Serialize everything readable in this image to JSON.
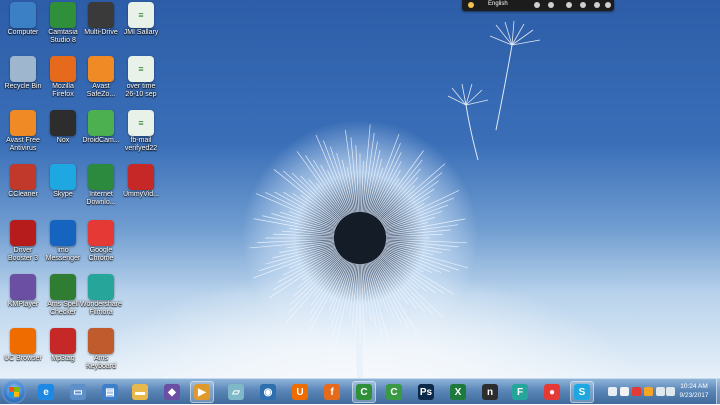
{
  "desktop": {
    "icons": [
      {
        "label": "Computer",
        "icon": "computer-icon",
        "color": "#3b7fc4"
      },
      {
        "label": "Camtasia\nStudio 8",
        "icon": "camtasia-icon",
        "color": "#2f8f3a"
      },
      {
        "label": "Multi-Drive",
        "icon": "nox-icon",
        "color": "#3a3a3a"
      },
      {
        "label": "JMI Sallary",
        "icon": "document-icon",
        "color": "#e8f2e8"
      },
      {
        "label": "Recycle Bin",
        "icon": "recycle-bin-icon",
        "color": "#9fb6cf"
      },
      {
        "label": "Mozilla\nFirefox",
        "icon": "firefox-icon",
        "color": "#e56a1c"
      },
      {
        "label": "Avast\nSafeZo...",
        "icon": "avast-icon",
        "color": "#f08a24"
      },
      {
        "label": "over time\n26-10 sep",
        "icon": "document-icon",
        "color": "#e8f2e8"
      },
      {
        "label": "Avast Free\nAntivirus",
        "icon": "avast-icon",
        "color": "#f08a24"
      },
      {
        "label": "Nox",
        "icon": "nox-icon",
        "color": "#2d2d2d"
      },
      {
        "label": "DroidCam...",
        "icon": "droidcam-icon",
        "color": "#4caf50"
      },
      {
        "label": "fb-mail\nverifyed22",
        "icon": "document-icon",
        "color": "#e8f2e8"
      },
      {
        "label": "CCleaner",
        "icon": "ccleaner-icon",
        "color": "#c0392b"
      },
      {
        "label": "Skype",
        "icon": "skype-icon",
        "color": "#1ea7e1"
      },
      {
        "label": "Internet\nDownlo...",
        "icon": "internet-download-icon",
        "color": "#2b8a3e"
      },
      {
        "label": "UmmyVid...",
        "icon": "download-icon",
        "color": "#c62828"
      },
      {
        "label": "Driver\nBooster 3",
        "icon": "driver-booster-icon",
        "color": "#b71c1c"
      },
      {
        "label": "imo\nMessenger",
        "icon": "imo-icon",
        "color": "#1565c0"
      },
      {
        "label": "Google\nChrome",
        "icon": "chrome-icon",
        "color": "#e53935"
      },
      {
        "label": "KMPlayer",
        "icon": "kmplayer-icon",
        "color": "#6a4fa3"
      },
      {
        "label": "Ams Spell\nChecker",
        "icon": "spell-checker-icon",
        "color": "#2e7d32"
      },
      {
        "label": "Wondershare\nFilmora",
        "icon": "filmora-icon",
        "color": "#26a69a"
      },
      {
        "label": "UC Browser",
        "icon": "uc-browser-icon",
        "color": "#ef6c00"
      },
      {
        "label": "Mp3tag",
        "icon": "mp3tag-icon",
        "color": "#c62828"
      },
      {
        "label": "Ams\nKeyboard",
        "icon": "keyboard-icon",
        "color": "#bf5b2c"
      }
    ]
  },
  "toolbar_widget": {
    "language": "English"
  },
  "taskbar": {
    "buttons": [
      {
        "name": "ie",
        "icon": "internet-explorer-icon",
        "glyph": "e",
        "color": "#1e88e5",
        "active": false
      },
      {
        "name": "window-switcher",
        "icon": "switch-windows-icon",
        "glyph": "▭",
        "color": "#5d8fc9",
        "active": false
      },
      {
        "name": "explorer-window",
        "icon": "window-icon",
        "glyph": "▤",
        "color": "#3f7fc8",
        "active": false
      },
      {
        "name": "file-explorer",
        "icon": "folder-icon",
        "glyph": "▬",
        "color": "#e8b84a",
        "active": false
      },
      {
        "name": "kmplayer",
        "icon": "kmplayer-icon",
        "glyph": "◆",
        "color": "#6a4fa3",
        "active": false
      },
      {
        "name": "media-player",
        "icon": "media-player-icon",
        "glyph": "▶",
        "color": "#e09a2b",
        "active": true
      },
      {
        "name": "notes",
        "icon": "notes-icon",
        "glyph": "▱",
        "color": "#7fb8c8",
        "active": false
      },
      {
        "name": "network-tool",
        "icon": "network-icon",
        "glyph": "◉",
        "color": "#2e6fb0",
        "active": false
      },
      {
        "name": "uc-browser",
        "icon": "uc-browser-icon",
        "glyph": "U",
        "color": "#ef6c00",
        "active": false
      },
      {
        "name": "firefox",
        "icon": "firefox-icon",
        "glyph": "f",
        "color": "#e56a1c",
        "active": false
      },
      {
        "name": "camtasia",
        "icon": "camtasia-icon",
        "glyph": "C",
        "color": "#2f8f3a",
        "active": true
      },
      {
        "name": "camtasia-recorder",
        "icon": "camtasia-icon",
        "glyph": "C",
        "color": "#3a9a44",
        "active": false
      },
      {
        "name": "photoshop",
        "icon": "photoshop-icon",
        "glyph": "Ps",
        "color": "#0b2a4a",
        "active": false
      },
      {
        "name": "excel",
        "icon": "excel-icon",
        "glyph": "X",
        "color": "#1e7a3c",
        "active": false
      },
      {
        "name": "nox",
        "icon": "nox-icon",
        "glyph": "n",
        "color": "#2d2d2d",
        "active": false
      },
      {
        "name": "filmora",
        "icon": "filmora-icon",
        "glyph": "F",
        "color": "#26a69a",
        "active": false
      },
      {
        "name": "chrome",
        "icon": "chrome-icon",
        "glyph": "●",
        "color": "#e53935",
        "active": false
      },
      {
        "name": "skype",
        "icon": "skype-icon",
        "glyph": "S",
        "color": "#1ea7e1",
        "active": true
      }
    ],
    "clock": {
      "time": "10:24 AM",
      "date": "9/23/2017"
    }
  }
}
